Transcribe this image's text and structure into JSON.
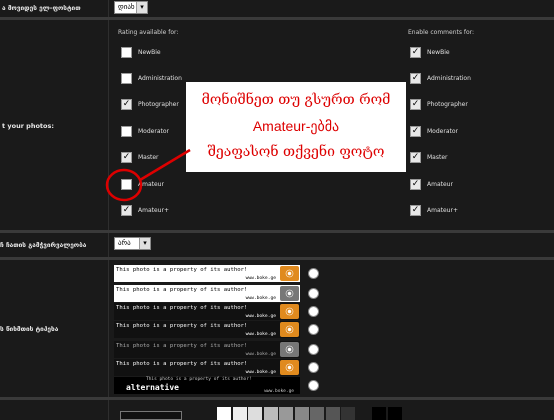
{
  "rows": {
    "top_label": "ა მოვიდეს ელ-ფოსტით",
    "top_select": "დიახ",
    "photos_label": "t your photos:",
    "sharpen_label": "ჩ ჩათის გამჭვირვალეობა",
    "sharpen_select": "არა",
    "watermark_label": "ს წიხმთის ტიპეხა"
  },
  "columns": {
    "rating_header": "Rating available for:",
    "comments_header": "Enable comments for:"
  },
  "rating_options": [
    {
      "label": "NewBie",
      "checked": false
    },
    {
      "label": "Administration",
      "checked": false
    },
    {
      "label": "Photographer",
      "checked": true
    },
    {
      "label": "Moderator",
      "checked": false
    },
    {
      "label": "Master",
      "checked": true
    },
    {
      "label": "Amateur",
      "checked": false
    },
    {
      "label": "Amateur+",
      "checked": true
    }
  ],
  "comment_options": [
    {
      "label": "NewBie",
      "checked": true
    },
    {
      "label": "Administration",
      "checked": true
    },
    {
      "label": "Photographer",
      "checked": true
    },
    {
      "label": "Moderator",
      "checked": true
    },
    {
      "label": "Master",
      "checked": true
    },
    {
      "label": "Amateur",
      "checked": true
    },
    {
      "label": "Amateur+",
      "checked": true
    }
  ],
  "callout": {
    "line1": "მონიშნეთ თუ გსურთ რომ",
    "line2": "Amateur-ებმა",
    "line3": "შეაფასონ თქვენი ფოტო"
  },
  "watermark": {
    "text": "This photo is a property of its author!",
    "site": "www.boke.ge",
    "alt_label": "alternative"
  },
  "colors": {
    "callout_text": "#dd0000",
    "callout_circle": "#dd0000",
    "logo_orange": "#e08a1e",
    "logo_gray": "#777777"
  }
}
